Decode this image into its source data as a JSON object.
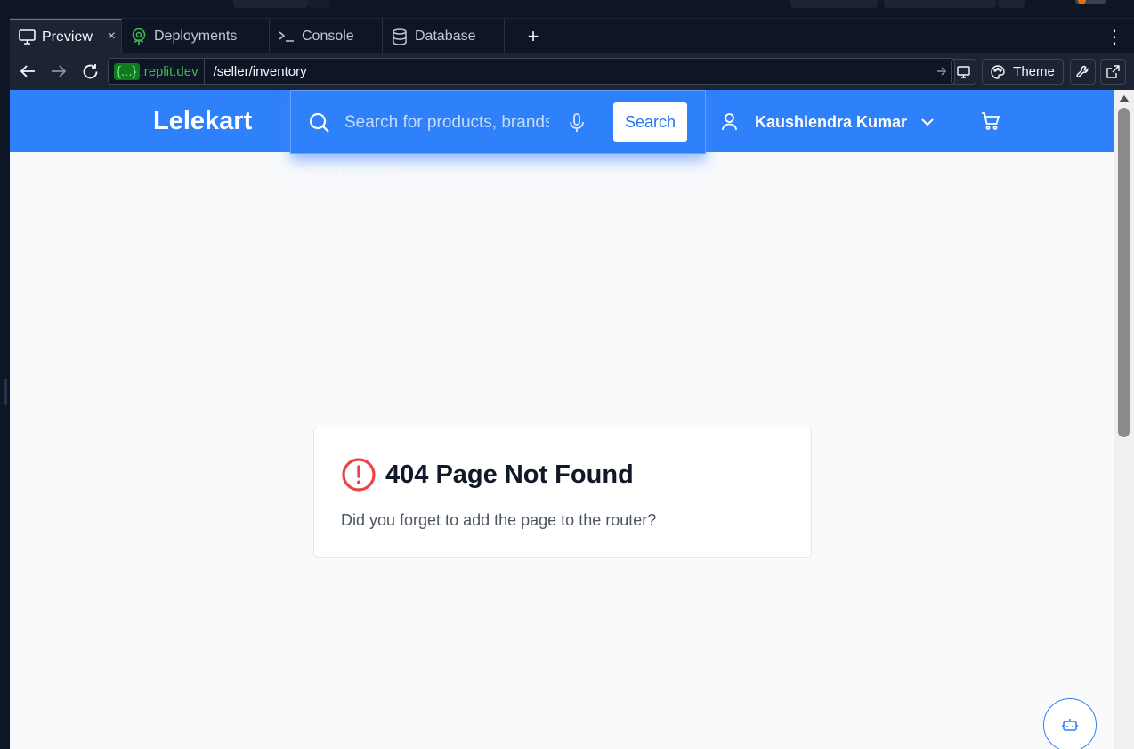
{
  "browser": {
    "tabs": [
      {
        "label": "Preview",
        "icon": "monitor-icon",
        "active": true,
        "closable": true
      },
      {
        "label": "Deployments",
        "icon": "deployments-icon",
        "active": false
      },
      {
        "label": "Console",
        "icon": "terminal-icon",
        "active": false
      },
      {
        "label": "Database",
        "icon": "database-icon",
        "active": false
      }
    ],
    "add_tab_label": "+",
    "more_menu_label": "⋮",
    "close_label": "×"
  },
  "addressbar": {
    "domain_brace": "{...}",
    "domain_suffix": ".replit.dev",
    "path": "/seller/inventory",
    "theme_label": "Theme"
  },
  "site": {
    "brand": "Lelekart",
    "search": {
      "placeholder": "Search for products, brands and more",
      "button_label": "Search",
      "hint": "Press / to search"
    },
    "user_name": "Kaushlendra Kumar"
  },
  "error": {
    "title": "404 Page Not Found",
    "message": "Did you forget to add the page to the router?"
  },
  "colors": {
    "header_blue": "#2f80fb",
    "error_red": "#ef4444",
    "ide_dark": "#0e1525",
    "ide_panel": "#1c2333"
  }
}
